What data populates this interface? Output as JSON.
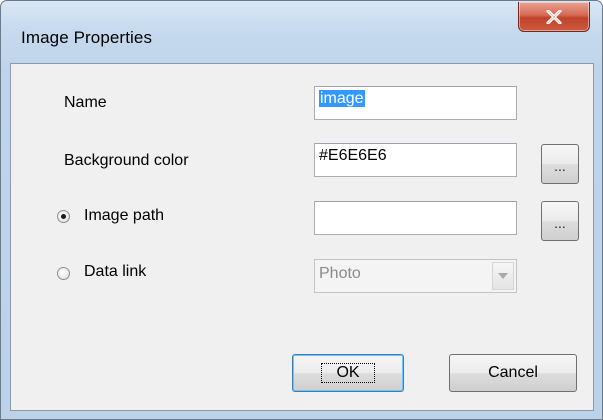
{
  "window": {
    "title": "Image Properties",
    "close_icon": "close-x-icon",
    "accent_color": "#c7432b"
  },
  "form": {
    "name": {
      "label": "Name",
      "value": "image"
    },
    "background_color": {
      "label": "Background color",
      "value": "#E6E6E6",
      "browse_label": "..."
    },
    "image_path": {
      "label": "Image path",
      "value": "",
      "selected": true,
      "browse_label": "..."
    },
    "data_link": {
      "label": "Data link",
      "selected": false,
      "value": "Photo"
    }
  },
  "buttons": {
    "ok_label": "OK",
    "cancel_label": "Cancel"
  }
}
